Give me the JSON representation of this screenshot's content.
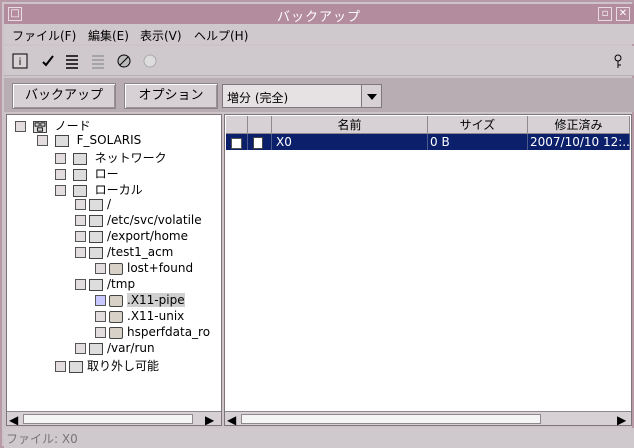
{
  "window": {
    "title": "バックアップ",
    "controls": [
      "□",
      "▫",
      "✕"
    ]
  },
  "menubar": {
    "items": [
      "ファイル(F)",
      "編集(E)",
      "表示(V)",
      "ヘルプ(H)"
    ]
  },
  "toolbar": {
    "icons": [
      "info-icon",
      "check-icon",
      "list-icon",
      "list-disabled-icon",
      "stop-icon",
      "record-icon",
      "key-icon"
    ]
  },
  "actionbar": {
    "backup_label": "バックアップ",
    "options_label": "オプション",
    "mode_value": "増分 (完全)"
  },
  "tree": {
    "root": "ノード",
    "host": "F_SOLARIS",
    "network": "ネットワーク",
    "ro": "ロー",
    "local": "ローカル",
    "items": [
      "/",
      "/etc/svc/volatile",
      "/export/home",
      "/test1_acm",
      "lost+found",
      "/tmp",
      ".X11-pipe",
      ".X11-unix",
      "hsperfdata_ro",
      "/var/run"
    ],
    "removable": "取り外し可能"
  },
  "table": {
    "headers": [
      "名前",
      "サイズ",
      "修正済み"
    ],
    "rows": [
      {
        "name": "X0",
        "size": "0 B",
        "modified": "2007/10/10 12:..."
      }
    ]
  },
  "status": {
    "text": "ファイル: X0"
  },
  "colors": {
    "titlebar": "#b38c9e",
    "selection": "#0b1f6b",
    "panel": "#cfc8cc"
  }
}
